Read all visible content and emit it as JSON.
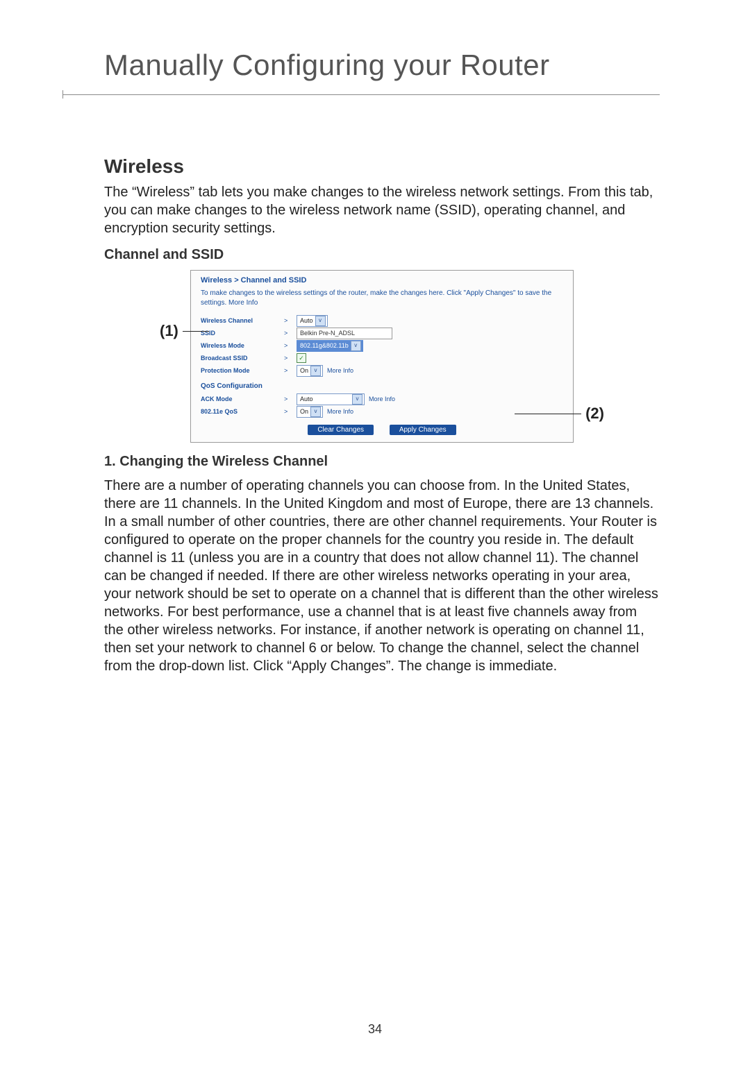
{
  "page": {
    "title": "Manually Configuring your Router",
    "number": "34"
  },
  "sections": {
    "heading1": "Wireless",
    "intro": "The “Wireless” tab lets you make changes to the wireless network settings. From this tab, you can make changes to the wireless network name (SSID), operating channel, and encryption security settings.",
    "heading2": "Channel and SSID",
    "heading3": "1. Changing the Wireless Channel",
    "body3": "There are a number of operating channels you can choose from. In the United States, there are 11 channels. In the United Kingdom and most of Europe, there are 13 channels. In a small number of other countries, there are other channel requirements. Your Router is configured to operate on the proper channels for the country you reside in. The default channel is 11 (unless you are in a country that does not allow channel 11). The channel can be changed if needed. If there are other wireless networks operating in your area, your network should be set to operate on a channel that is different than the other wireless networks. For best performance, use a channel that is at least five channels away from the other wireless networks. For instance, if another network is operating on channel 11, then set your network to channel 6 or below. To change the channel, select the channel from the drop-down list. Click “Apply Changes”. The change is immediate."
  },
  "callouts": {
    "left": "(1)",
    "right": "(2)"
  },
  "panel": {
    "breadcrumb": "Wireless > Channel and SSID",
    "intro": "To make changes to the wireless settings of the router, make the changes here. Click \"Apply Changes\" to save the settings. ",
    "more_info": "More Info",
    "rows": {
      "wireless_channel": {
        "label": "Wireless Channel",
        "value": "Auto"
      },
      "ssid": {
        "label": "SSID",
        "value": "Belkin Pre-N_ADSL"
      },
      "wireless_mode": {
        "label": "Wireless Mode",
        "value": "802.11g&802.11b"
      },
      "broadcast_ssid": {
        "label": "Broadcast SSID",
        "checked": "✓"
      },
      "protection_mode": {
        "label": "Protection Mode",
        "value": "On"
      }
    },
    "qos_heading": "QoS Configuration",
    "qos": {
      "ack_mode": {
        "label": "ACK Mode",
        "value": "Auto"
      },
      "e_qos": {
        "label": "802.11e QoS",
        "value": "On"
      }
    },
    "buttons": {
      "clear": "Clear Changes",
      "apply": "Apply Changes"
    }
  }
}
